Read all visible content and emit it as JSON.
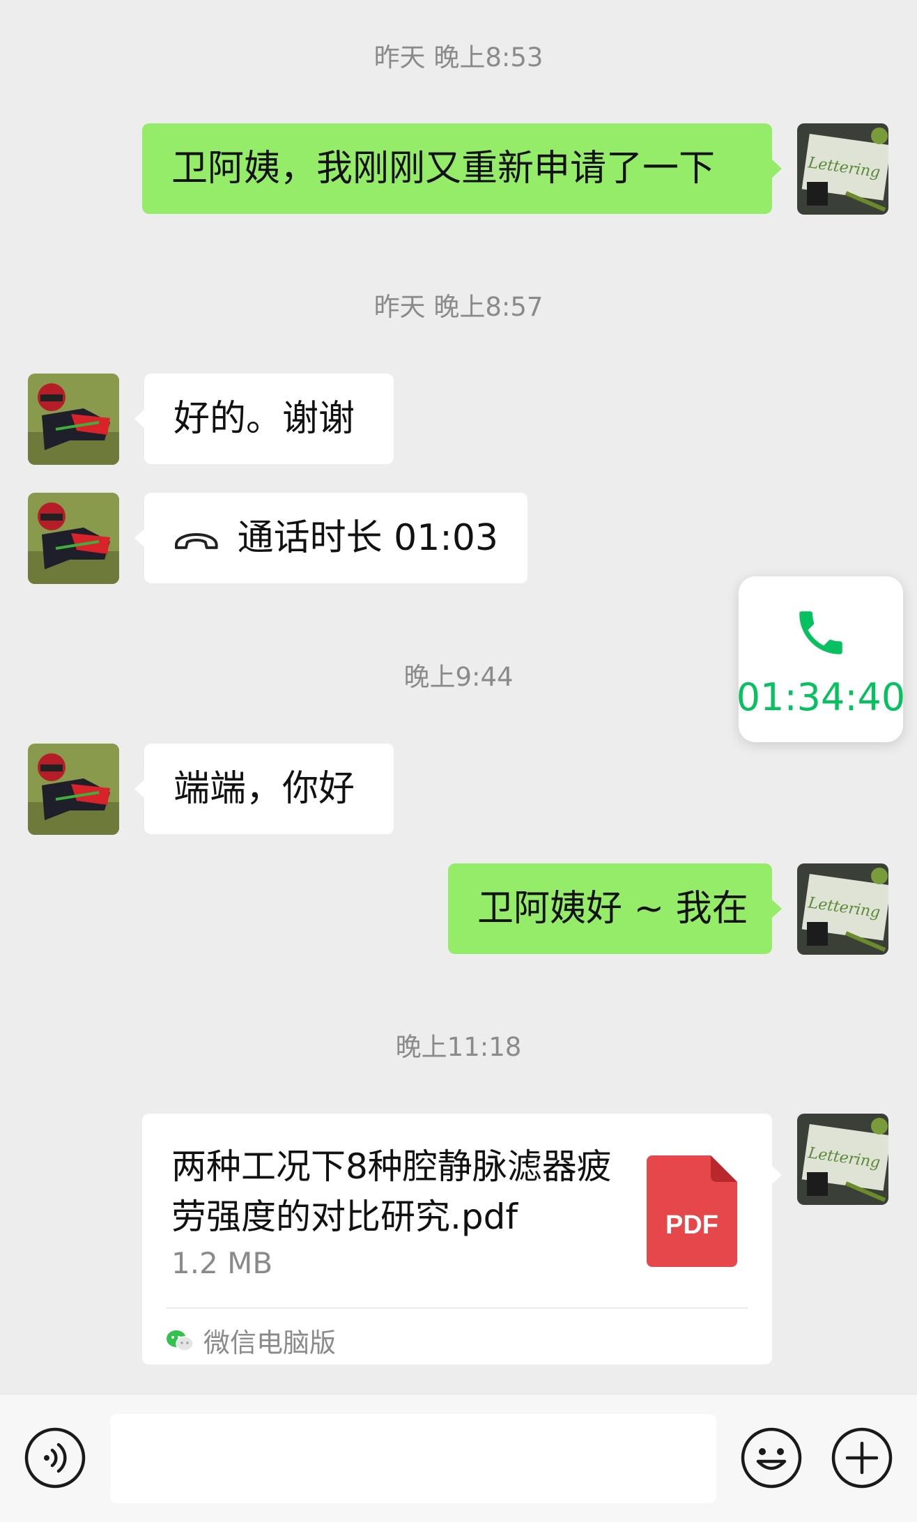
{
  "messages": {
    "ts1": "昨天 晚上8:53",
    "msg1": "卫阿姨，我刚刚又重新申请了一下",
    "ts2": "昨天 晚上8:57",
    "msg2": "好的。谢谢",
    "msg3": "通话时长 01:03",
    "ts3": "晚上9:44",
    "msg4": "端端，你好",
    "msg5": "卫阿姨好 ~ 我在",
    "ts4": "晚上11:18"
  },
  "floating_call": {
    "icon": "phone-icon",
    "duration": "01:34:40"
  },
  "file": {
    "name": "两种工况下8种腔静脉滤器疲劳强度的对比研究.pdf",
    "size": "1.2 MB",
    "type_label": "PDF",
    "source": "微信电脑版"
  },
  "input_bar": {
    "voice_icon": "voice-icon",
    "emoji_icon": "emoji-icon",
    "plus_icon": "plus-icon",
    "text_value": ""
  },
  "colors": {
    "outgoing_bubble": "#95ec69",
    "incoming_bubble": "#ffffff",
    "background": "#ededed",
    "accent_green": "#07c160",
    "pdf_red": "#e5474a"
  }
}
